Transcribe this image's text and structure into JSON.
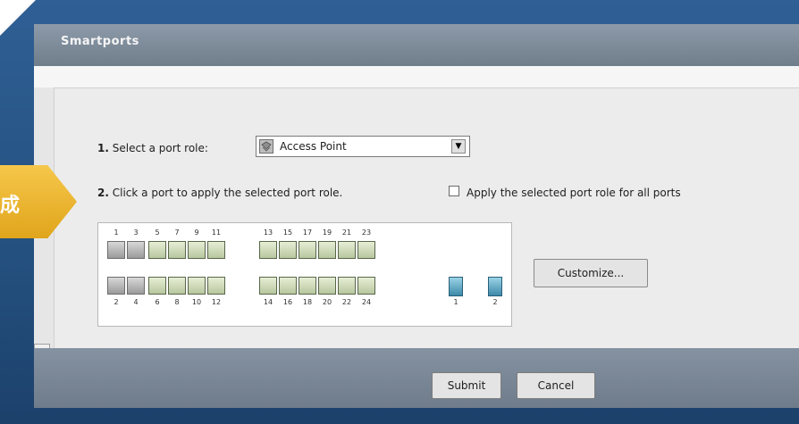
{
  "window": {
    "title": "Smartports"
  },
  "callout": {
    "text": "成"
  },
  "step1": {
    "number": "1.",
    "label": "Select a port role:",
    "selected_role": "Access Point",
    "role_icon": "access-point-icon"
  },
  "step2": {
    "number": "2.",
    "label": "Click a port to apply the selected port role.",
    "apply_all_label": "Apply the selected port role for all ports",
    "apply_all_checked": false
  },
  "ports": {
    "top_numbers": [
      "1",
      "3",
      "5",
      "7",
      "9",
      "11",
      "13",
      "15",
      "17",
      "19",
      "21",
      "23"
    ],
    "bottom_numbers": [
      "2",
      "4",
      "6",
      "8",
      "10",
      "12",
      "14",
      "16",
      "18",
      "20",
      "22",
      "24"
    ],
    "uplink_numbers": [
      "1",
      "2"
    ],
    "top_roles": [
      "access-point",
      "access-point",
      "standard",
      "standard",
      "standard",
      "standard",
      "standard",
      "standard",
      "standard",
      "standard",
      "standard",
      "standard"
    ],
    "bottom_roles": [
      "access-point",
      "access-point",
      "standard",
      "standard",
      "standard",
      "standard",
      "standard",
      "standard",
      "standard",
      "standard",
      "standard",
      "standard"
    ]
  },
  "buttons": {
    "customize": "Customize...",
    "submit": "Submit",
    "cancel": "Cancel"
  },
  "colors": {
    "accent_blue": "#24507f",
    "callout_orange": "#e8b32b"
  }
}
